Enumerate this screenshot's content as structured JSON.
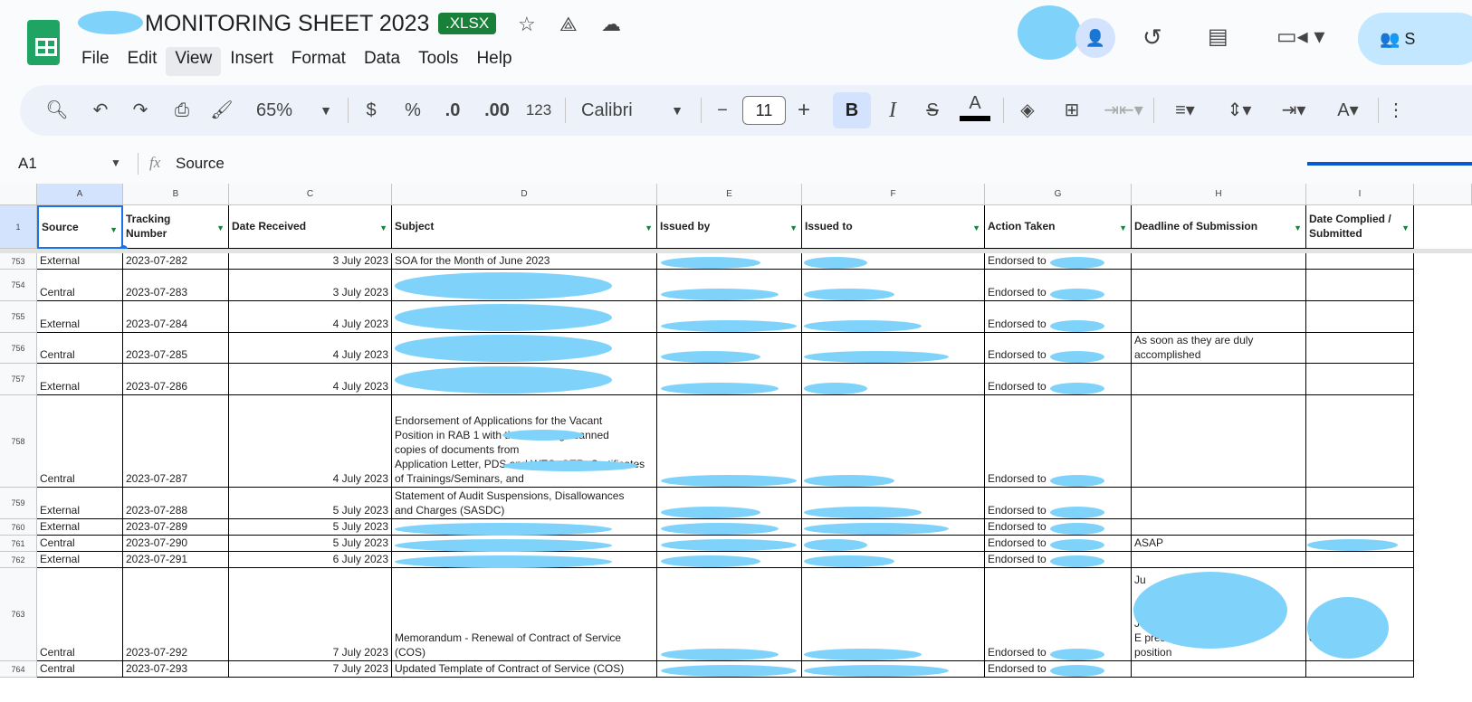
{
  "app": {
    "title": "MONITORING SHEET 2023",
    "badge": ".XLSX",
    "menu": [
      "File",
      "Edit",
      "View",
      "Insert",
      "Format",
      "Data",
      "Tools",
      "Help"
    ],
    "active_menu": "View",
    "share_label": "S"
  },
  "toolbar": {
    "zoom": "65%",
    "currency": "$",
    "percent": "%",
    "dec_less": ".0",
    "dec_more": ".00",
    "format_123": "123",
    "font": "Calibri",
    "font_size": "11",
    "minus": "−",
    "plus": "+",
    "bold": "B",
    "italic": "I",
    "strike": "S",
    "text_color": "A"
  },
  "formula": {
    "cell_ref": "A1",
    "fx": "fx",
    "value": "Source"
  },
  "columns": [
    "A",
    "B",
    "C",
    "D",
    "E",
    "F",
    "G",
    "H",
    "I"
  ],
  "headers": [
    "Source",
    "Tracking Number",
    "Date Received",
    "Subject",
    "Issued by",
    "Issued to",
    "Action Taken",
    "Deadline of Submission",
    "Date Complied / Submitted"
  ],
  "header_row": "1",
  "rows": [
    {
      "n": "753",
      "cells": [
        "External",
        "2023-07-282",
        "3 July 2023",
        "SOA for the Month of June 2023",
        "",
        "",
        "Endorsed to",
        "",
        ""
      ]
    },
    {
      "n": "754",
      "cells": [
        "Central",
        "2023-07-283",
        "3 July 2023",
        "",
        "",
        "",
        "Endorsed to",
        "",
        ""
      ]
    },
    {
      "n": "755",
      "cells": [
        "External",
        "2023-07-284",
        "4 July 2023",
        "",
        "",
        "",
        "Endorsed to",
        "",
        ""
      ]
    },
    {
      "n": "756",
      "cells": [
        "Central",
        "2023-07-285",
        "4 July 2023",
        "",
        "",
        "",
        "Endorsed to",
        "As soon as they are duly\naccomplished",
        ""
      ]
    },
    {
      "n": "757",
      "cells": [
        "External",
        "2023-07-286",
        "4 July 2023",
        "",
        "",
        "",
        "Endorsed to",
        "",
        ""
      ]
    },
    {
      "n": "758",
      "cells": [
        "Central",
        "2023-07-287",
        "4 July 2023",
        "Endorsement of Applications for the Vacant\nPosition in RAB 1 with the following scanned\ncopies of documents from\nApplication Letter, PDS and WES, OTR, Certificates\nof Trainings/Seminars,                                          and\n ",
        "",
        "",
        "Endorsed to",
        "",
        ""
      ]
    },
    {
      "n": "759",
      "cells": [
        "External",
        "2023-07-288",
        "5 July 2023",
        "Statement of Audit Suspensions, Disallowances\nand Charges (SASDC)",
        "",
        "",
        "Endorsed to",
        "",
        ""
      ]
    },
    {
      "n": "760",
      "cells": [
        "External",
        "2023-07-289",
        "5 July 2023",
        "",
        "",
        "",
        "Endorsed to",
        "",
        ""
      ]
    },
    {
      "n": "761",
      "cells": [
        "Central",
        "2023-07-290",
        "5 July 2023",
        "",
        "",
        "",
        "Endorsed to",
        "ASAP",
        ""
      ]
    },
    {
      "n": "762",
      "cells": [
        "External",
        "2023-07-291",
        "6 July 2023",
        "",
        "",
        "",
        "Endorsed to",
        "",
        ""
      ]
    },
    {
      "n": "763",
      "cells": [
        "Central",
        "2023-07-292",
        "7 July 2023",
        "Memorandum - Renewal of Contract of Service\n(COS)",
        "",
        "",
        "Endorsed to",
        "Ju\n\n\nJu\nE                                   present\nposition",
        "\n\n\n\nen                         rier\n"
      ]
    },
    {
      "n": "764",
      "cells": [
        "Central",
        "2023-07-293",
        "7 July 2023",
        "Updated Template of Contract of Service (COS)",
        "",
        "",
        "Endorsed to",
        "",
        ""
      ]
    }
  ],
  "colors": {
    "accent": "#188038",
    "selection": "#1a73e8",
    "redaction": "#7fd3fb"
  }
}
